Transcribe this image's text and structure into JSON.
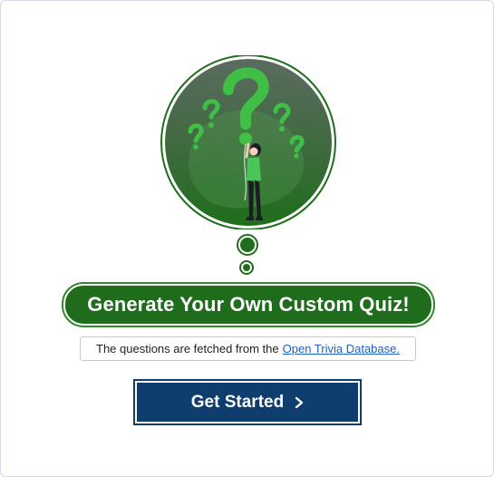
{
  "hero": {
    "title": "Generate Your Own Custom Quiz!",
    "illustration_icon": "question-marks-person-icon"
  },
  "info": {
    "prefix": "The questions are fetched from the",
    "link_text": "Open Trivia Database."
  },
  "actions": {
    "start_label": "Get Started",
    "start_icon": "chevron-right-icon"
  },
  "colors": {
    "primary_green": "#1f6c1c",
    "accent_green": "#3fbf46",
    "button_navy": "#0e3d6e",
    "link_blue": "#1a5fc8"
  }
}
